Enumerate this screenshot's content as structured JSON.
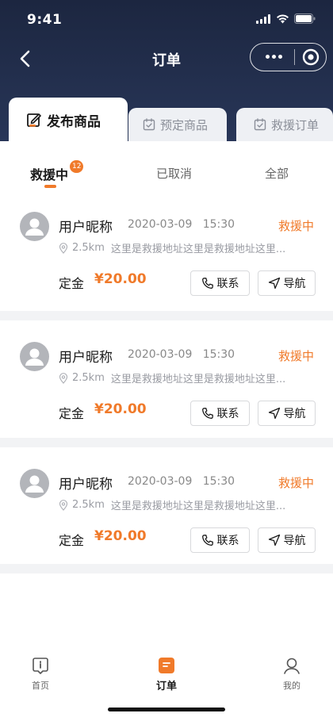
{
  "status_bar": {
    "time": "9:41"
  },
  "nav": {
    "title": "订单"
  },
  "category_tabs": [
    {
      "label": "发布商品",
      "active": true
    },
    {
      "label": "预定商品",
      "active": false
    },
    {
      "label": "救援订单",
      "active": false
    }
  ],
  "sub_tabs": {
    "rescue": {
      "label": "救援中",
      "badge": "12"
    },
    "cancelled": {
      "label": "已取消"
    },
    "all": {
      "label": "全部"
    }
  },
  "orders": [
    {
      "user_name": "用户昵称",
      "time": "2020-03-09   15:30",
      "status": "救援中",
      "distance": "2.5km",
      "address": "这里是救援地址这里是救援地址这里...",
      "deposit_label": "定金",
      "deposit": "¥20.00",
      "contact_label": "联系",
      "navigate_label": "导航"
    },
    {
      "user_name": "用户昵称",
      "time": "2020-03-09   15:30",
      "status": "救援中",
      "distance": "2.5km",
      "address": "这里是救援地址这里是救援地址这里...",
      "deposit_label": "定金",
      "deposit": "¥20.00",
      "contact_label": "联系",
      "navigate_label": "导航"
    },
    {
      "user_name": "用户昵称",
      "time": "2020-03-09   15:30",
      "status": "救援中",
      "distance": "2.5km",
      "address": "这里是救援地址这里是救援地址这里...",
      "deposit_label": "定金",
      "deposit": "¥20.00",
      "contact_label": "联系",
      "navigate_label": "导航"
    }
  ],
  "tabbar": {
    "home": {
      "label": "首页",
      "icon": "home-icon"
    },
    "orders": {
      "label": "订单",
      "icon": "order-icon",
      "active": true
    },
    "mine": {
      "label": "我的",
      "icon": "user-icon"
    }
  },
  "colors": {
    "accent": "#f07a2a",
    "header": "#1c2640",
    "text": "#1a1a1a",
    "muted": "#9a9ca3"
  }
}
